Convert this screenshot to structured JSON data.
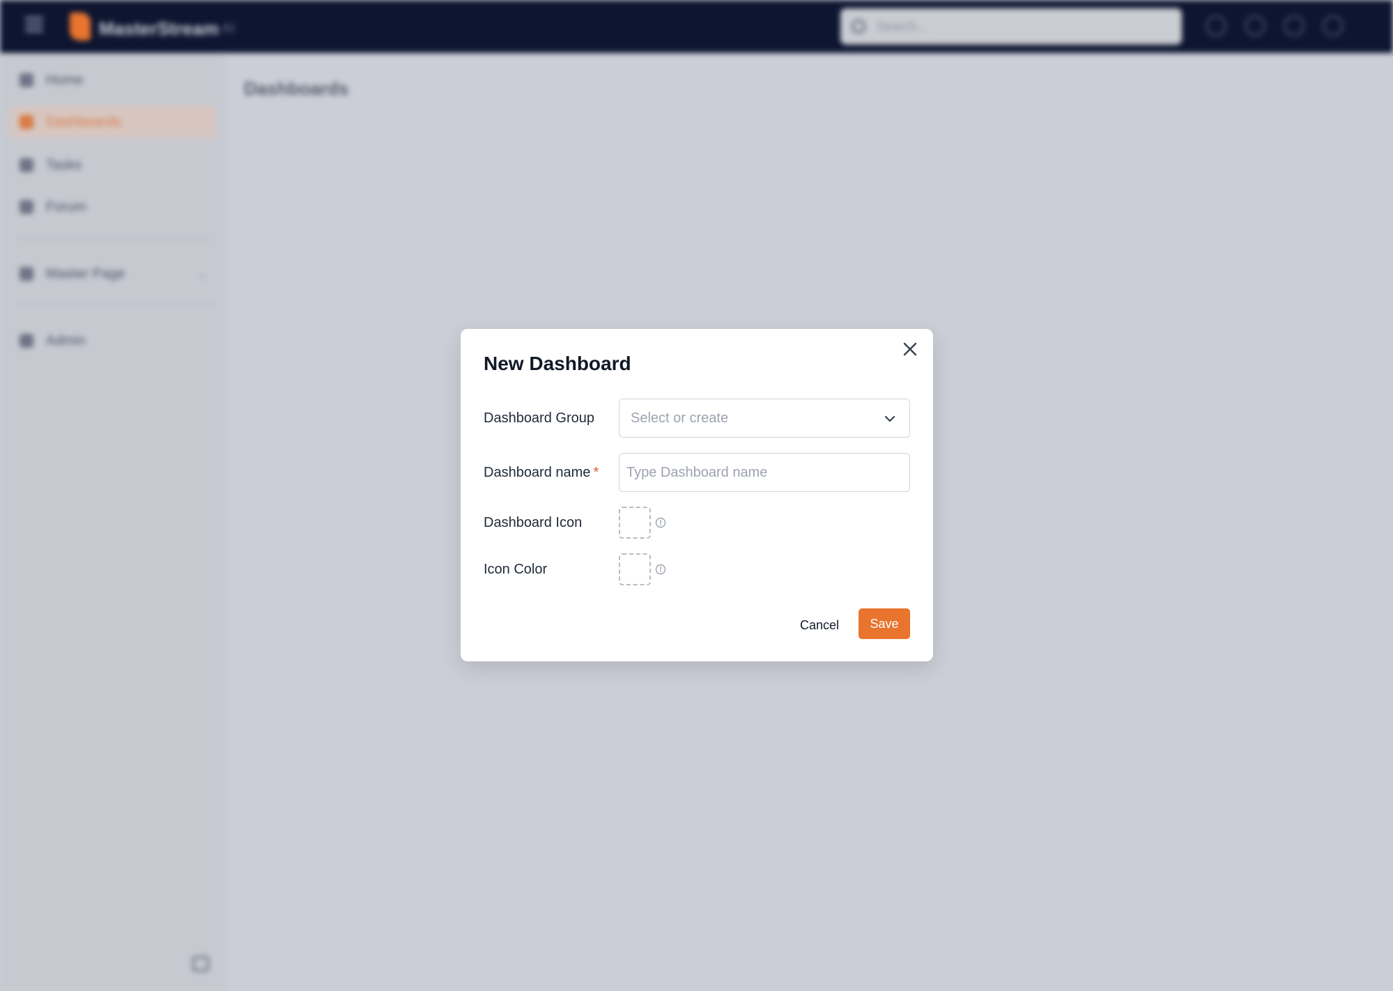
{
  "app": {
    "brand": "MasterStream",
    "brand_suffix": "AI",
    "search_placeholder": "Search...",
    "page_title": "Dashboards",
    "accent_color": "#e8742e",
    "sidebar": {
      "items": [
        {
          "label": "Home",
          "icon": "home-icon"
        },
        {
          "label": "Dashboards",
          "icon": "dashboard-icon",
          "active": true
        },
        {
          "label": "Tasks",
          "icon": "tasks-icon"
        },
        {
          "label": "Forum",
          "icon": "forum-icon"
        }
      ],
      "group": {
        "label": "Master Page",
        "icon": "folder-icon"
      },
      "admin": {
        "label": "Admin",
        "icon": "admin-icon"
      }
    },
    "top_icons": [
      "help-icon",
      "settings-icon",
      "notifications-icon",
      "user-icon"
    ]
  },
  "modal": {
    "title": "New Dashboard",
    "fields": {
      "group": {
        "label": "Dashboard Group",
        "placeholder": "Select or create"
      },
      "name": {
        "label": "Dashboard name",
        "required_mark": "*",
        "placeholder": "Type Dashboard name",
        "value": ""
      },
      "icon": {
        "label": "Dashboard Icon"
      },
      "color": {
        "label": "Icon Color"
      }
    },
    "buttons": {
      "cancel": "Cancel",
      "save": "Save"
    }
  }
}
